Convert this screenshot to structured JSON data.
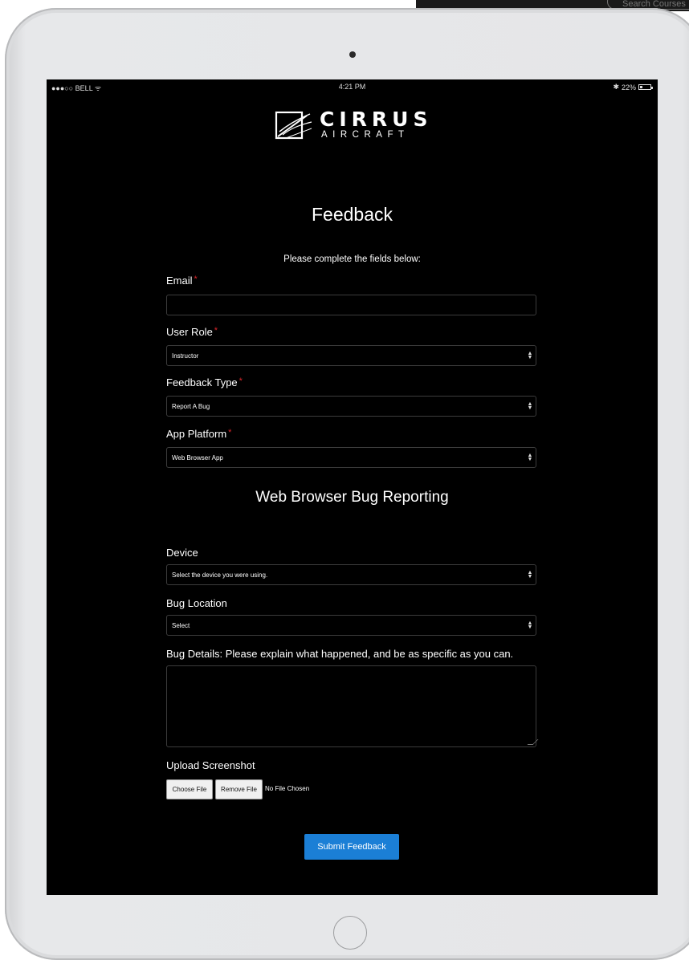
{
  "background": {
    "search_placeholder": "Search Courses"
  },
  "status_bar": {
    "carrier": "●●●○○ BELL ᯤ",
    "time": "4:21 PM",
    "battery": "22%",
    "battery_level": 0.22
  },
  "brand": {
    "name": "CIRRUS",
    "sub": "AIRCRAFT"
  },
  "page": {
    "title": "Feedback",
    "subtitle": "Please complete the fields below:",
    "section_title": "Web Browser Bug Reporting"
  },
  "form": {
    "required_mark": "*",
    "email": {
      "label": "Email",
      "value": ""
    },
    "user_role": {
      "label": "User Role",
      "value": "Instructor"
    },
    "feedback_type": {
      "label": "Feedback Type",
      "value": "Report A Bug"
    },
    "app_platform": {
      "label": "App Platform",
      "value": "Web Browser App"
    },
    "device": {
      "label": "Device",
      "value": "Select the device you were using."
    },
    "bug_location": {
      "label": "Bug Location",
      "value": "Select"
    },
    "bug_details": {
      "label": "Bug Details: Please explain what happened, and be as specific as you can.",
      "value": ""
    },
    "upload": {
      "label": "Upload Screenshot",
      "choose_label": "Choose File",
      "remove_label": "Remove File",
      "status": "No File Chosen"
    },
    "submit_label": "Submit Feedback"
  },
  "colors": {
    "accent": "#1b7fd6",
    "required": "#d9262b",
    "screen": "#000000"
  }
}
